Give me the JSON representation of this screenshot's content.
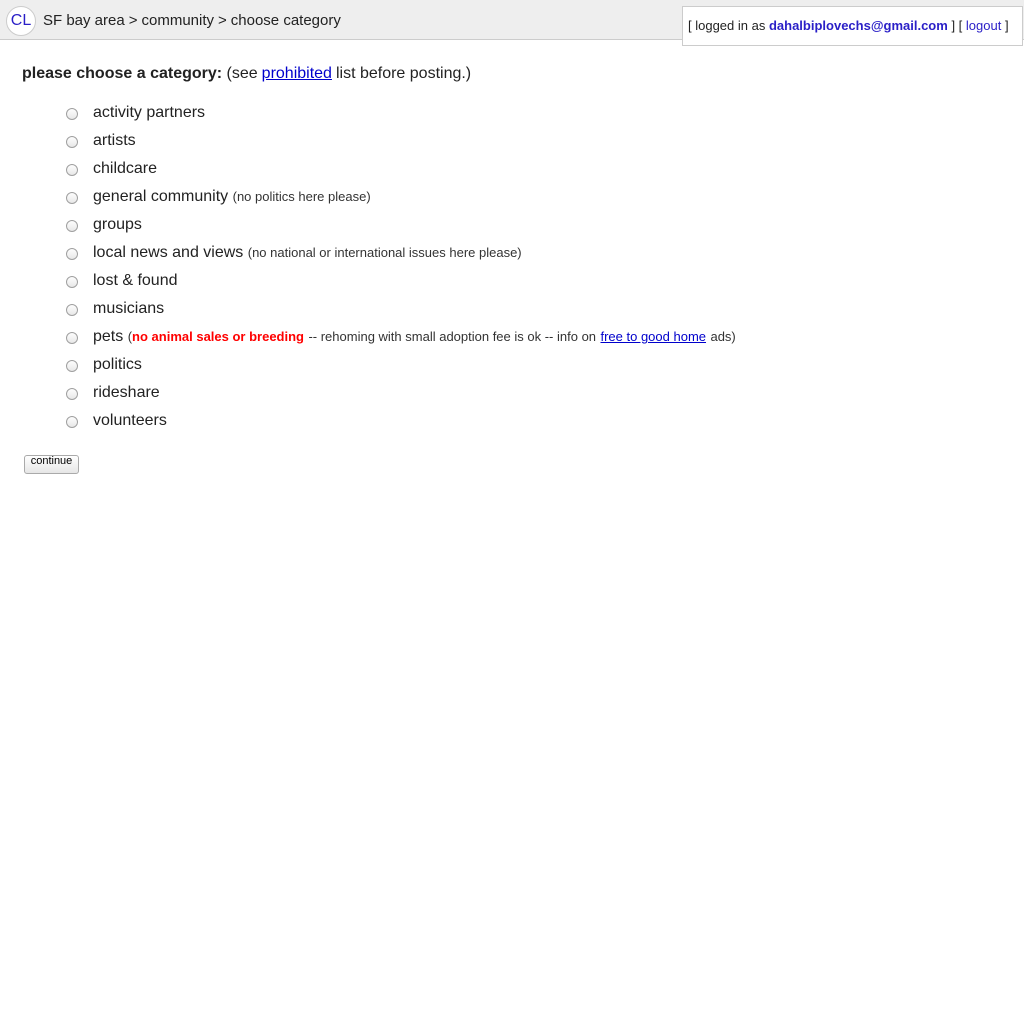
{
  "header": {
    "logo": "CL",
    "breadcrumb": [
      "SF bay area",
      "community",
      "choose category"
    ],
    "separator": ">",
    "user": {
      "prefix": "[ logged in as",
      "email": "dahalbiplovechs@gmail.com",
      "mid": "] [",
      "logout": "logout",
      "suffix": "]"
    }
  },
  "prompt": {
    "label": "please choose a category:",
    "pre": "(see",
    "link": "prohibited",
    "post": "list before posting.)"
  },
  "categories": [
    {
      "label": "activity partners"
    },
    {
      "label": "artists"
    },
    {
      "label": "childcare"
    },
    {
      "label": "general community",
      "note": "(no politics here please)"
    },
    {
      "label": "groups"
    },
    {
      "label": "local news and views",
      "note": "(no national or international issues here please)"
    },
    {
      "label": "lost & found"
    },
    {
      "label": "musicians"
    },
    {
      "label": "pets",
      "open": "(",
      "warning": "no animal sales or breeding",
      "note_mid": "-- rehoming with small adoption fee is ok -- info on",
      "note_link": "free to good home",
      "close": "ads)"
    },
    {
      "label": "politics"
    },
    {
      "label": "rideshare"
    },
    {
      "label": "volunteers"
    }
  ],
  "continue_label": "continue",
  "colors": {
    "link": "#0000cc",
    "warning": "#ff0000",
    "header_bg": "#eeeeee",
    "email": "#2a1fc7"
  }
}
